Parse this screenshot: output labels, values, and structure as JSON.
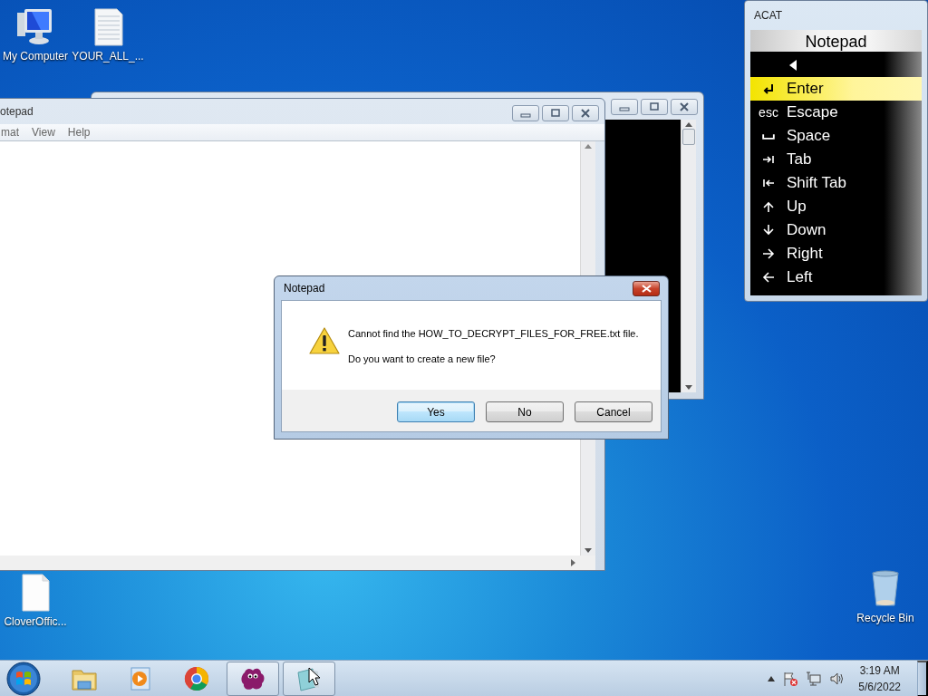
{
  "desktop_icons": [
    {
      "label": "My Computer",
      "kind": "computer"
    },
    {
      "label": "YOUR_ALL_...",
      "kind": "document"
    },
    {
      "label": "CloverOffic...",
      "kind": "blank"
    },
    {
      "label": "Recycle Bin",
      "kind": "recycle"
    }
  ],
  "notepad_window": {
    "title": "otepad",
    "menu": [
      "mat",
      "View",
      "Help"
    ]
  },
  "dialog": {
    "title": "Notepad",
    "message": "Cannot find the HOW_TO_DECRYPT_FILES_FOR_FREE.txt file.",
    "question": "Do you want to create a new file?",
    "buttons": [
      {
        "label": "Yes",
        "default": true
      },
      {
        "label": "No",
        "default": false
      },
      {
        "label": "Cancel",
        "default": false
      }
    ]
  },
  "acat": {
    "title": "ACAT",
    "header": "Notepad",
    "items": [
      {
        "kind": "back",
        "selected": false
      },
      {
        "kind": "enter",
        "label": "Enter",
        "selected": true
      },
      {
        "kind": "text",
        "symbol": "esc",
        "label": "Escape",
        "selected": false
      },
      {
        "kind": "space",
        "label": "Space",
        "selected": false
      },
      {
        "kind": "tab",
        "label": "Tab",
        "selected": false
      },
      {
        "kind": "shift-tab",
        "label": "Shift Tab",
        "selected": false
      },
      {
        "kind": "up",
        "label": "Up",
        "selected": false
      },
      {
        "kind": "down",
        "label": "Down",
        "selected": false
      },
      {
        "kind": "right",
        "label": "Right",
        "selected": false
      },
      {
        "kind": "left",
        "label": "Left",
        "selected": false
      }
    ]
  },
  "taskbar": {
    "apps": [
      {
        "kind": "folder",
        "running": false
      },
      {
        "kind": "media",
        "running": false
      },
      {
        "kind": "browser",
        "running": false
      },
      {
        "kind": "blob",
        "running": true
      },
      {
        "kind": "notepad",
        "running": true
      }
    ],
    "clock": {
      "time": "3:19 AM",
      "date": "5/6/2022"
    }
  }
}
